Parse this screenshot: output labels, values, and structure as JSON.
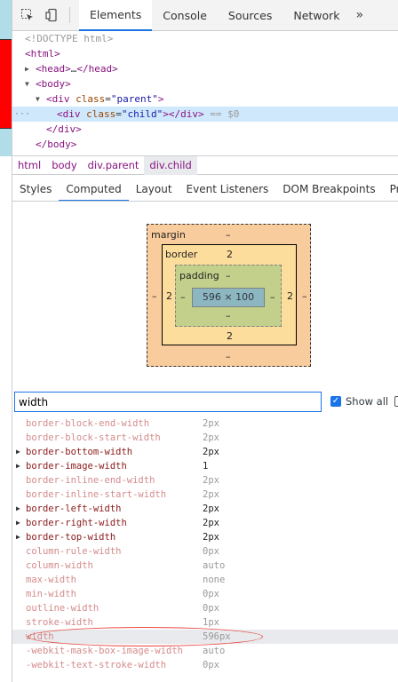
{
  "toolbar": {
    "tabs": [
      "Elements",
      "Console",
      "Sources",
      "Network"
    ],
    "more": "»"
  },
  "dom": {
    "line1": "<!DOCTYPE html>",
    "html_open": "<html>",
    "head_tag": "<head>",
    "head_ellipsis": "…",
    "head_close": "</head>",
    "body_open": "<body>",
    "div_open": "<div",
    "attr_name": "class",
    "parent_value": "\"parent\"",
    "gt": ">",
    "child_value": "\"child\"",
    "child_close": "></div>",
    "eq_marker": "== $0",
    "div_close": "</div>",
    "body_close": "</body>",
    "selected_dots": "···"
  },
  "breadcrumbs": [
    "html",
    "body",
    "div.parent",
    "div.child"
  ],
  "subtabs": [
    "Styles",
    "Computed",
    "Layout",
    "Event Listeners",
    "DOM Breakpoints",
    "Prope"
  ],
  "box_model": {
    "margin_label": "margin",
    "margin_top": "–",
    "margin_left": "–",
    "margin_right": "–",
    "margin_bottom": "–",
    "border_label": "border",
    "border_top": "2",
    "border_left": "2",
    "border_right": "2",
    "border_bottom": "2",
    "padding_label": "padding",
    "padding_top": "–",
    "padding_left": "–",
    "padding_right": "–",
    "padding_bottom": "–",
    "content": "596 × 100"
  },
  "filter": {
    "value": "width",
    "show_all": "Show all",
    "show_all_checked": true
  },
  "properties": [
    {
      "name": "border-block-end-width",
      "value": "2px",
      "expandable": false
    },
    {
      "name": "border-block-start-width",
      "value": "2px",
      "expandable": false
    },
    {
      "name": "border-bottom-width",
      "value": "2px",
      "expandable": true
    },
    {
      "name": "border-image-width",
      "value": "1",
      "expandable": true
    },
    {
      "name": "border-inline-end-width",
      "value": "2px",
      "expandable": false
    },
    {
      "name": "border-inline-start-width",
      "value": "2px",
      "expandable": false
    },
    {
      "name": "border-left-width",
      "value": "2px",
      "expandable": true
    },
    {
      "name": "border-right-width",
      "value": "2px",
      "expandable": true
    },
    {
      "name": "border-top-width",
      "value": "2px",
      "expandable": true
    },
    {
      "name": "column-rule-width",
      "value": "0px",
      "expandable": false
    },
    {
      "name": "column-width",
      "value": "auto",
      "expandable": false
    },
    {
      "name": "max-width",
      "value": "none",
      "expandable": false
    },
    {
      "name": "min-width",
      "value": "0px",
      "expandable": false
    },
    {
      "name": "outline-width",
      "value": "0px",
      "expandable": false
    },
    {
      "name": "stroke-width",
      "value": "1px",
      "expandable": false
    },
    {
      "name": "width",
      "value": "596px",
      "expandable": false
    },
    {
      "name": "-webkit-mask-box-image-width",
      "value": "auto",
      "expandable": false
    },
    {
      "name": "-webkit-text-stroke-width",
      "value": "0px",
      "expandable": false
    }
  ]
}
